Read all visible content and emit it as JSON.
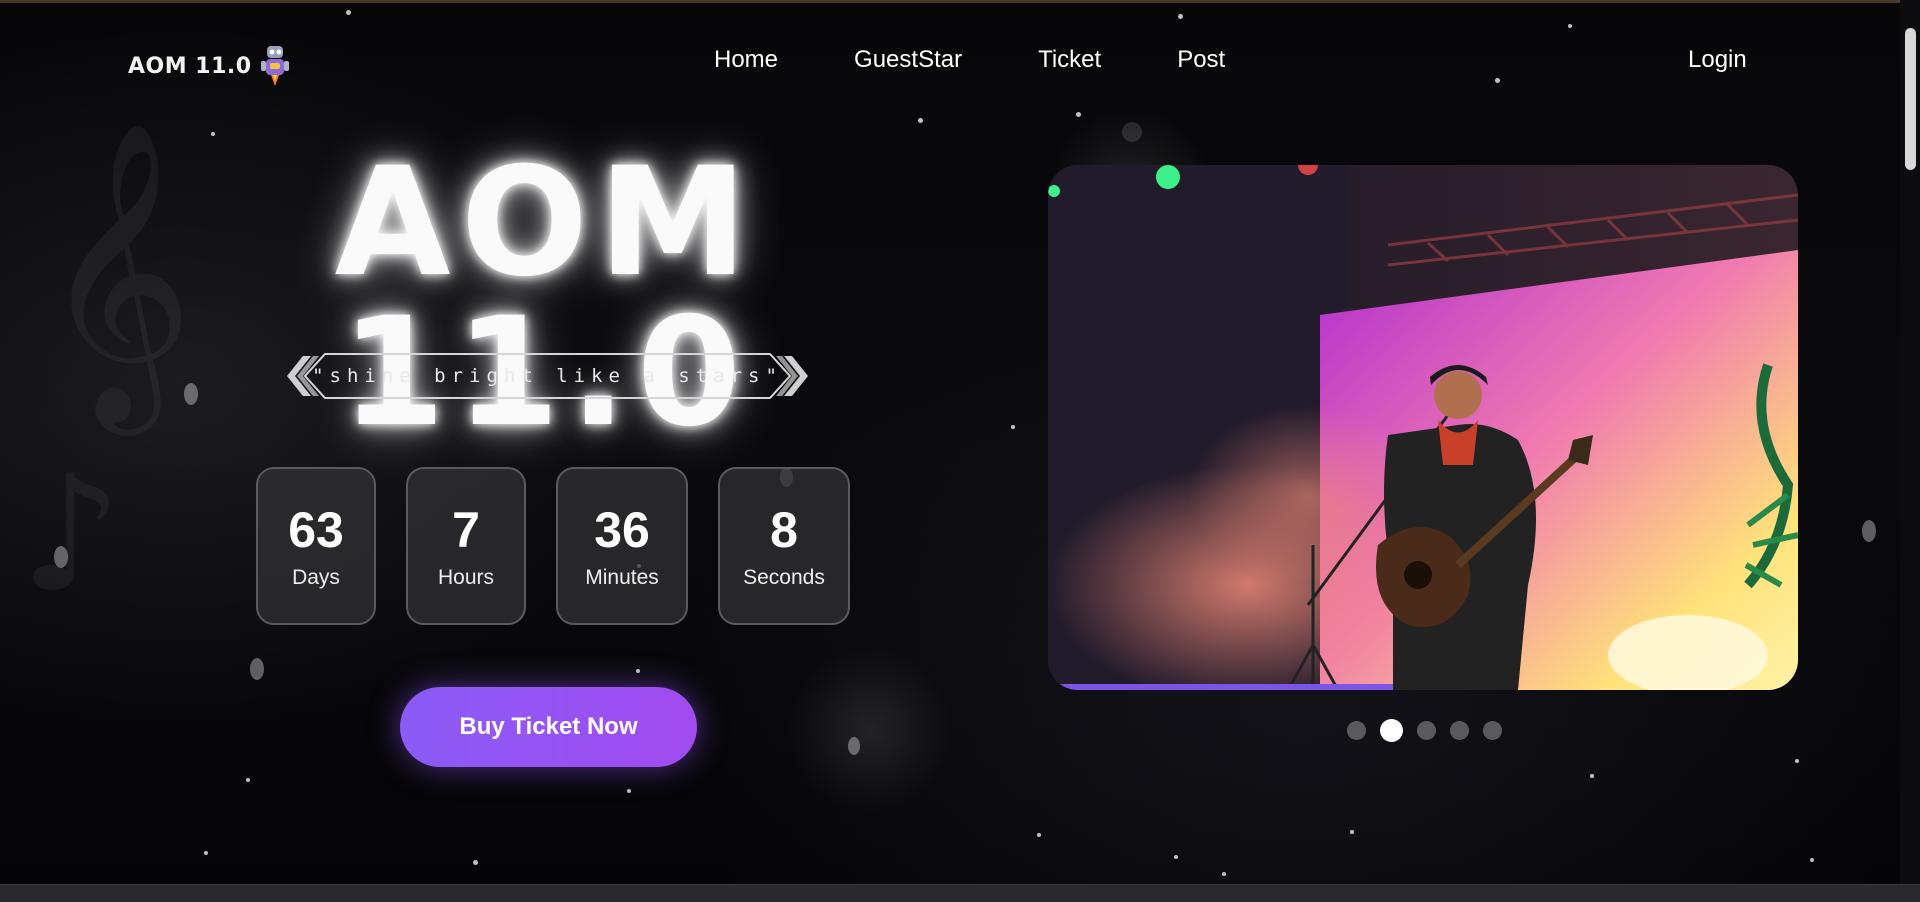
{
  "nav": {
    "brand": "AOM 11.0",
    "links": [
      "Home",
      "GuestStar",
      "Ticket",
      "Post"
    ],
    "login": "Login"
  },
  "hero": {
    "title": "AOM 11.0",
    "tagline": "\"shine bright like a stars\""
  },
  "countdown": [
    {
      "value": "63",
      "label": "Days"
    },
    {
      "value": "7",
      "label": "Hours"
    },
    {
      "value": "36",
      "label": "Minutes"
    },
    {
      "value": "8",
      "label": "Seconds"
    }
  ],
  "cta": {
    "label": "Buy Ticket Now"
  },
  "carousel": {
    "slides": 5,
    "active_index": 1,
    "progress": 0.46
  },
  "colors": {
    "accent": "#8a5cf6",
    "background": "#050507"
  }
}
